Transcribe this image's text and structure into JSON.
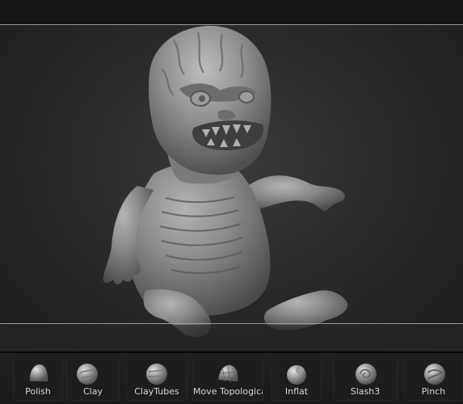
{
  "shelf": {
    "brushes": [
      {
        "label": "Polish",
        "icon": "polish-brush-icon"
      },
      {
        "label": "Clay",
        "icon": "clay-brush-icon"
      },
      {
        "label": "ClayTubes",
        "icon": "claytubes-brush-icon"
      },
      {
        "label": "Move Topologica",
        "icon": "move-topological-brush-icon"
      },
      {
        "label": "Inflat",
        "icon": "inflat-brush-icon"
      },
      {
        "label": "Slash3",
        "icon": "slash3-brush-icon"
      },
      {
        "label": "Pinch",
        "icon": "pinch-brush-icon"
      }
    ]
  },
  "colors": {
    "viewport_bg": "#2b2b2b",
    "model_clay": "#8a8a8a",
    "shelf_bg": "#1d1d1d",
    "label_text": "#d6d6d6"
  }
}
